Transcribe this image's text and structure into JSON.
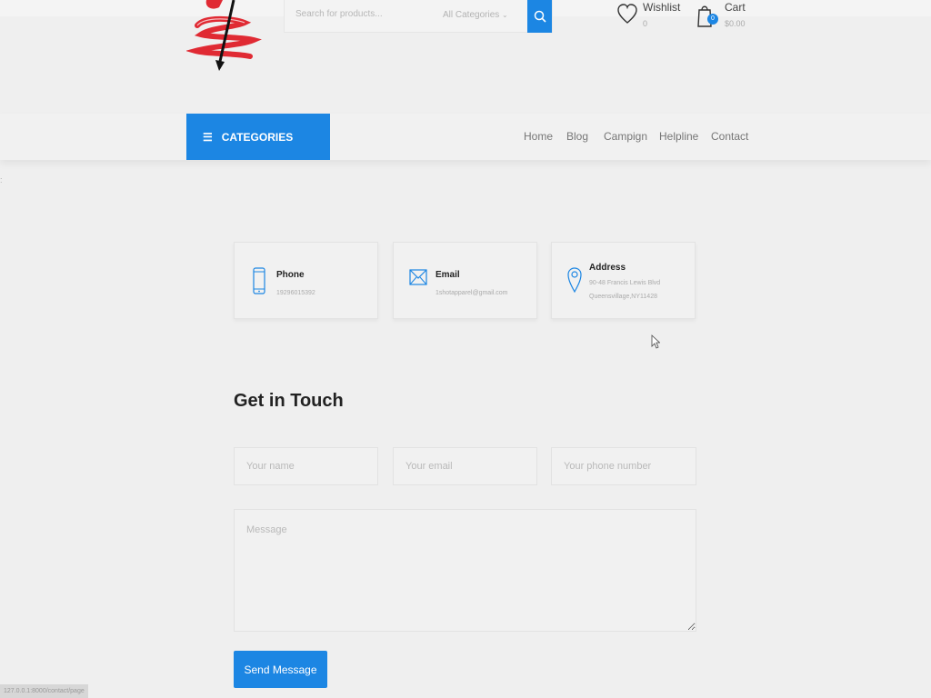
{
  "header": {
    "search_placeholder": "Search for products...",
    "category_select": "All Categories",
    "wishlist_label": "Wishlist",
    "wishlist_count": "0",
    "cart_label": "Cart",
    "cart_badge": "0",
    "cart_amount": "$0.00"
  },
  "nav": {
    "categories_label": "CATEGORIES",
    "links": [
      "Home",
      "Blog",
      "Campign",
      "Helpline",
      "Contact"
    ]
  },
  "contact_cards": [
    {
      "title": "Phone",
      "lines": [
        "19296015392"
      ],
      "icon": "phone-icon"
    },
    {
      "title": "Email",
      "lines": [
        "1shotapparel@gmail.com"
      ],
      "icon": "email-icon"
    },
    {
      "title": "Address",
      "lines": [
        "90-48 Francis Lewis Blvd",
        "Queensvillage,NY11428"
      ],
      "icon": "location-icon"
    }
  ],
  "form": {
    "title": "Get in Touch",
    "name_placeholder": "Your name",
    "email_placeholder": "Your email",
    "phone_placeholder": "Your phone number",
    "message_placeholder": "Message",
    "submit_label": "Send Message"
  },
  "statusbar": {
    "url": "127.0.0.1:8000/contact/page"
  },
  "colors": {
    "accent": "#1c86e3",
    "background": "#efefef",
    "logo_red": "#e02a33"
  }
}
